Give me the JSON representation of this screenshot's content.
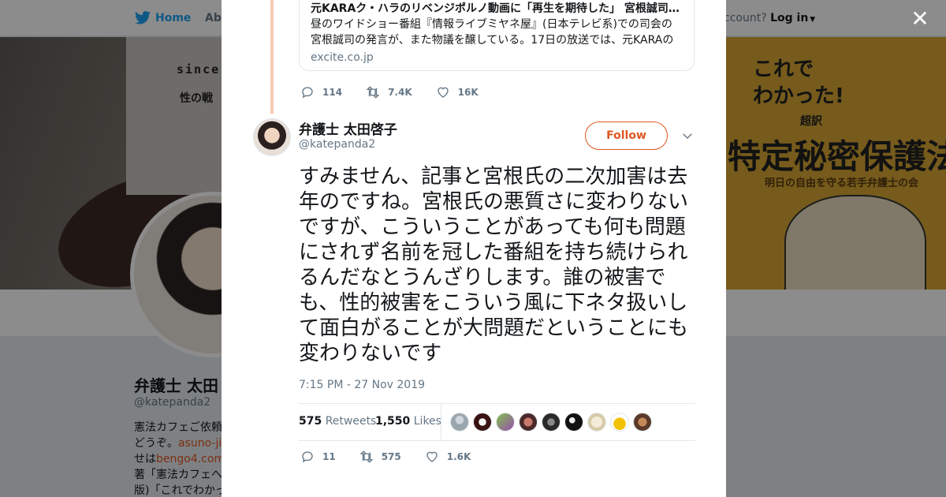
{
  "bg": {
    "nav": {
      "home": "Home",
      "about": "Abo",
      "account": "ccount?",
      "login": "Log in"
    },
    "banner": {
      "since": "since",
      "sei": "性の戦",
      "book_kore": "これで",
      "book_wakatta": "わかった!",
      "book_chou": "超訳",
      "book_title": "特定秘密保護法",
      "book_sub": "明日の自由を守る若手弁護士の会"
    },
    "profile": {
      "name": "弁護士 太田",
      "handle": "@katepanda2",
      "bio_1": "憲法カフェご依頼",
      "bio_2a": "どうぞ。",
      "bio_2b": "asuno-jiy",
      "bio_3a": "せは",
      "bio_3b": "bengo4.com/",
      "bio_4": "著「憲法カフェへ",
      "bio_5": "版)「これでわかっ"
    }
  },
  "modal": {
    "card": {
      "title": "元KARAク・ハラのリベンジポルノ動画に「再生を期待した」 宮根誠司…",
      "desc": "昼のワイドショー番組『情報ライブミヤネ屋』(日本テレビ系)での司会の宮根誠司の発言が、また物議を醸している。17日の放送では、元KARAのメ…",
      "domain": "excite.co.jp"
    },
    "prev_actions": {
      "replies": "114",
      "retweets": "7.4K",
      "likes": "16K"
    },
    "tweet": {
      "name": "弁護士 太田啓子",
      "handle": "@katepanda2",
      "follow_label": "Follow",
      "text": "すみません、記事と宮根氏の二次加害は去年のですね。宮根氏の悪質さに変わりないですが、こういうことがあっても何も問題にされず名前を冠した番組を持ち続けられるんだなとうんざりします。誰の被害でも、性的被害をこういう風に下ネタ扱いして面白がることが大問題だということにも変わりないです",
      "time": "7:15 PM - 27 Nov 2019",
      "retweet_count": "575",
      "retweet_label": "Retweets",
      "like_count": "1,550",
      "like_label": "Likes"
    },
    "tweet_actions": {
      "replies": "11",
      "retweets": "575",
      "likes": "1.6K"
    }
  },
  "colors": {
    "accent": "#e0561f",
    "twitter_blue": "#1da1f2",
    "muted": "#657786",
    "text": "#14171a"
  }
}
